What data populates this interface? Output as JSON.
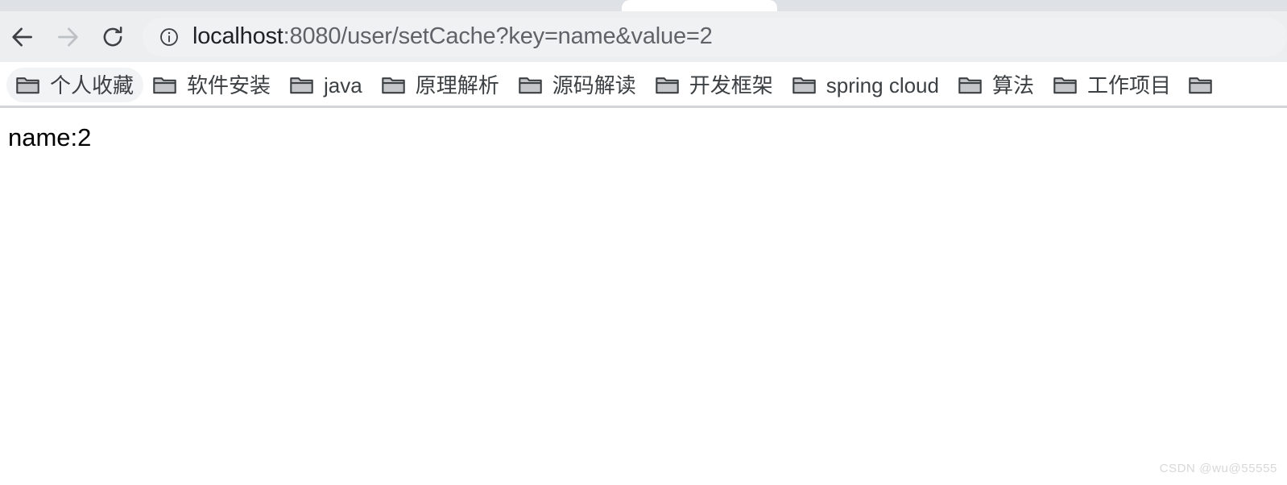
{
  "browser": {
    "tabstrip": {
      "active_tab_name": "active-tab"
    },
    "toolbar": {
      "back_icon": "back-arrow-icon",
      "forward_icon": "forward-arrow-icon",
      "reload_icon": "reload-icon",
      "omnibox": {
        "site_info_icon": "info-circle-icon",
        "url_host": "localhost",
        "url_path": ":8080/user/setCache?key=name&value=2",
        "url_full": "localhost:8080/user/setCache?key=name&value=2"
      }
    },
    "bookmarks": {
      "folder_icon": "folder-icon",
      "items": [
        {
          "label": "个人收藏",
          "hovered": true
        },
        {
          "label": "软件安装",
          "hovered": false
        },
        {
          "label": "java",
          "hovered": false
        },
        {
          "label": "原理解析",
          "hovered": false
        },
        {
          "label": "源码解读",
          "hovered": false
        },
        {
          "label": "开发框架",
          "hovered": false
        },
        {
          "label": "spring cloud",
          "hovered": false
        },
        {
          "label": "算法",
          "hovered": false
        },
        {
          "label": "工作项目",
          "hovered": false
        },
        {
          "label": "",
          "hovered": false
        }
      ]
    }
  },
  "page": {
    "body_text": "name:2",
    "watermark": "CSDN @wu@55555"
  },
  "colors": {
    "tabstrip_bg": "#dee1e6",
    "toolbar_bg": "#eceef0",
    "omnibox_bg": "#eff1f3",
    "bookmark_hover_bg": "#f1f3f4",
    "text_primary": "#202124",
    "text_secondary": "#5f6368",
    "page_bg": "#ffffff"
  }
}
